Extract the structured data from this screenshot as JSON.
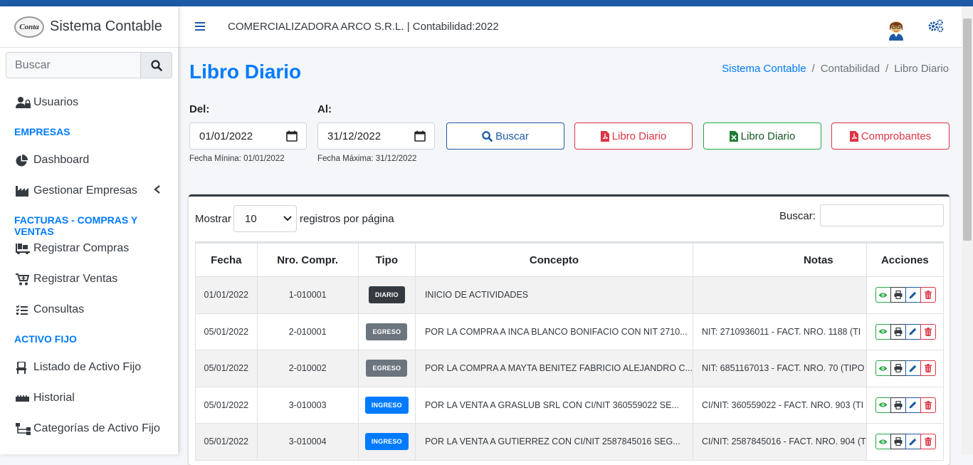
{
  "brand": {
    "logo_text": "Conta",
    "name": "Sistema Contable"
  },
  "sidebar": {
    "search_placeholder": "Buscar",
    "items": [
      {
        "label": "Usuarios",
        "icon": "users-lock-icon"
      },
      {
        "header": "EMPRESAS"
      },
      {
        "label": "Dashboard",
        "icon": "chart-pie-icon"
      },
      {
        "label": "Gestionar Empresas",
        "icon": "industry-icon"
      },
      {
        "header": "FACTURAS - COMPRAS Y VENTAS"
      },
      {
        "label": "Registrar Compras",
        "icon": "dolly-icon"
      },
      {
        "label": "Registrar Ventas",
        "icon": "cart-plus-icon"
      },
      {
        "label": "Consultas",
        "icon": "tasks-icon"
      },
      {
        "header": "ACTIVO FIJO"
      },
      {
        "label": "Listado de Activo Fijo",
        "icon": "chair-icon"
      },
      {
        "label": "Historial",
        "icon": "ruler-icon"
      },
      {
        "label": "Categorías de Activo Fijo",
        "icon": "sitemap-icon"
      }
    ]
  },
  "header": {
    "company": "COMERCIALIZADORA ARCO S.R.L. | Contabilidad:2022"
  },
  "page": {
    "title": "Libro Diario",
    "breadcrumb": [
      "Sistema Contable",
      "Contabilidad",
      "Libro Diario"
    ]
  },
  "filters": {
    "del_label": "Del:",
    "al_label": "Al:",
    "del_value": "01/01/2022",
    "al_value": "31/12/2022",
    "del_hint": "Fecha Mínina: 01/01/2022",
    "al_hint": "Fecha Máxima: 31/12/2022"
  },
  "buttons": {
    "buscar": "Buscar",
    "pdf_libro": "Libro Diario",
    "excel_libro": "Libro Diario",
    "comprobantes": "Comprobantes"
  },
  "table_controls": {
    "mostrar": "Mostrar",
    "page_size": "10",
    "per_page": "registros por página",
    "buscar": "Buscar:"
  },
  "table": {
    "columns": [
      "Fecha",
      "Nro. Compr.",
      "Tipo",
      "Concepto",
      "Notas",
      "Acciones"
    ],
    "rows": [
      {
        "fecha": "01/01/2022",
        "nro": "1-010001",
        "tipo": "DIARIO",
        "concepto": "INICIO DE ACTIVIDADES",
        "notas": ""
      },
      {
        "fecha": "05/01/2022",
        "nro": "2-010001",
        "tipo": "EGRESO",
        "concepto": "POR LA COMPRA A INCA BLANCO BONIFACIO CON NIT 2710...",
        "notas": "NIT: 2710936011 - FACT. NRO. 1188 (TI"
      },
      {
        "fecha": "05/01/2022",
        "nro": "2-010002",
        "tipo": "EGRESO",
        "concepto": "POR LA COMPRA A MAYTA BENITEZ FABRICIO ALEJANDRO C...",
        "notas": "NIT: 6851167013 - FACT. NRO. 70 (TIPO"
      },
      {
        "fecha": "05/01/2022",
        "nro": "3-010003",
        "tipo": "INGRESO",
        "concepto": "POR LA VENTA A GRASLUB SRL CON CI/NIT 360559022 SE...",
        "notas": "CI/NIT: 360559022 - FACT. NRO. 903 (TI"
      },
      {
        "fecha": "05/01/2022",
        "nro": "3-010004",
        "tipo": "INGRESO",
        "concepto": "POR LA VENTA A GUTIERREZ CON CI/NIT 2587845016 SEG...",
        "notas": "CI/NIT: 2587845016 - FACT. NRO. 904 (T"
      }
    ]
  },
  "colors": {
    "primary": "#007bff",
    "diario": "#343a40",
    "egreso": "#6c757d",
    "ingreso": "#007bff",
    "top_strip": "#1d5aa5"
  }
}
